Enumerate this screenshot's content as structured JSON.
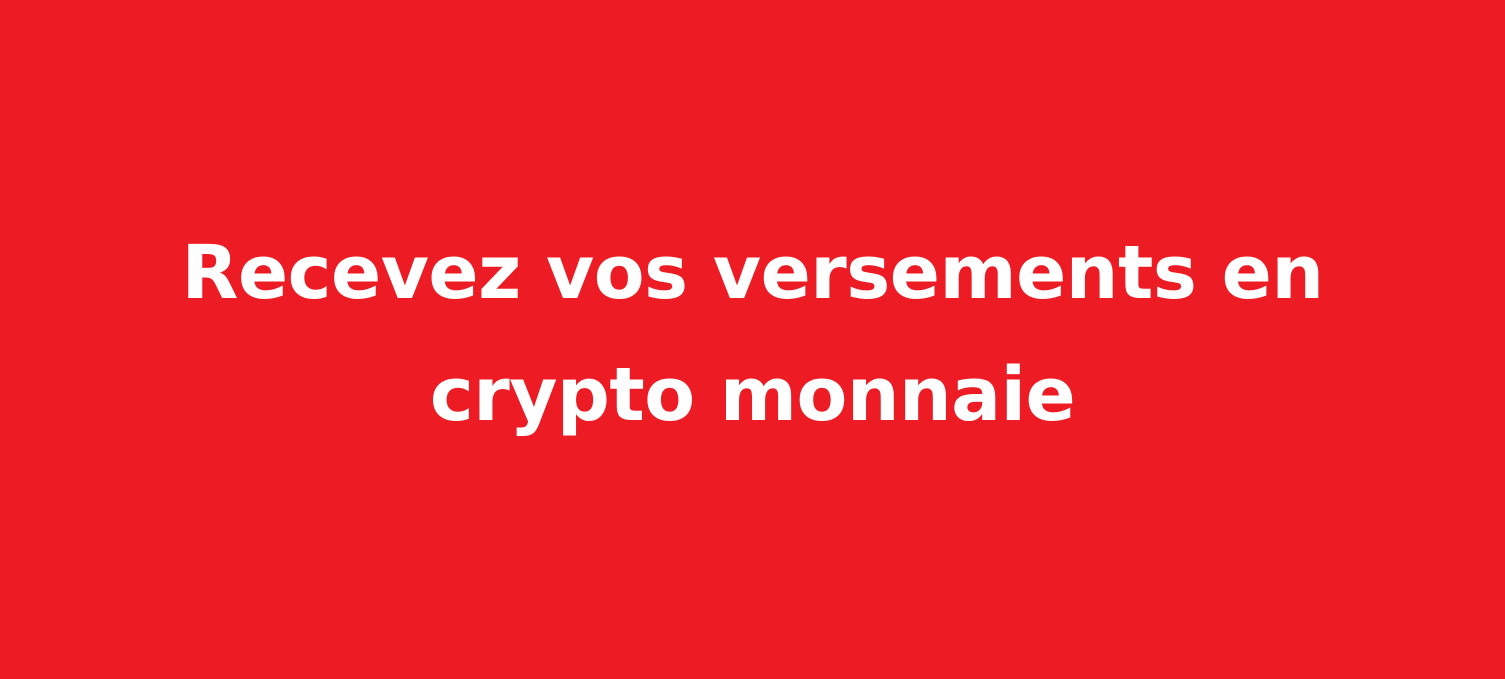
{
  "banner": {
    "background_color": "#ED1C24",
    "text_color": "#FFFFFF",
    "headline_lines": [
      "Recevez vos versements en",
      "crypto monnaie"
    ]
  }
}
